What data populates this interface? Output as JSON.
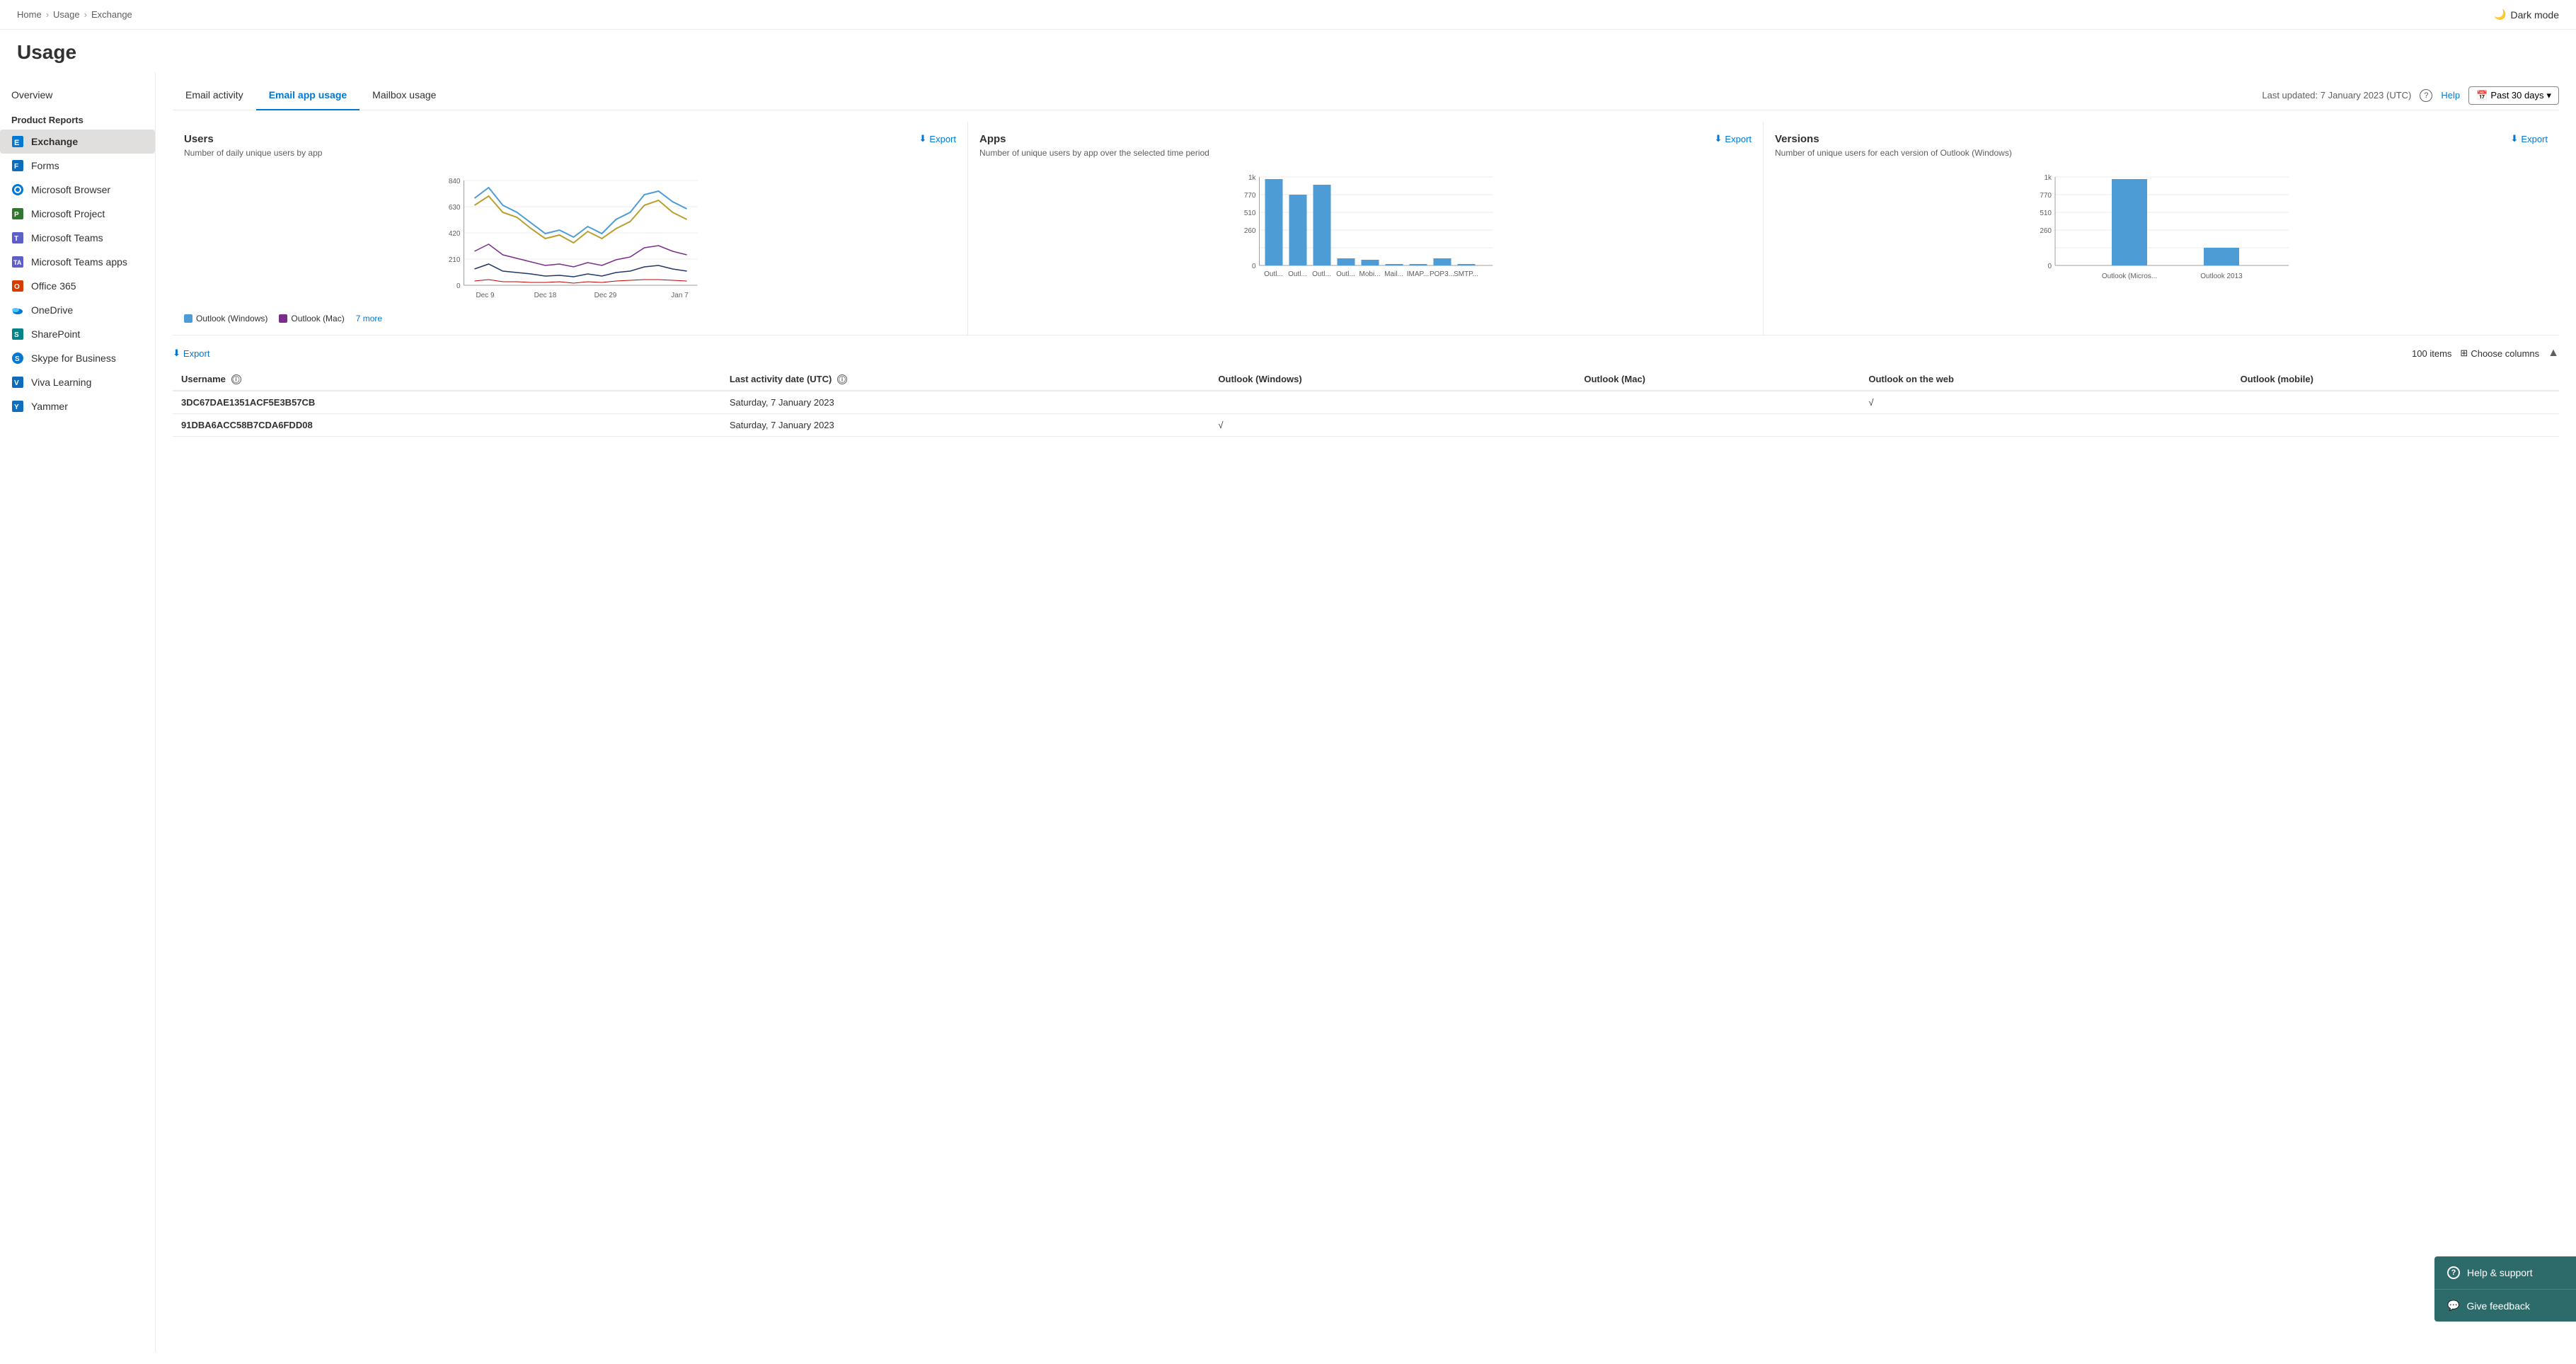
{
  "breadcrumb": {
    "home": "Home",
    "usage": "Usage",
    "exchange": "Exchange",
    "sep": "›"
  },
  "darkMode": {
    "label": "Dark mode"
  },
  "page": {
    "title": "Usage"
  },
  "sidebar": {
    "overview_label": "Overview",
    "section_title": "Product Reports",
    "items": [
      {
        "id": "exchange",
        "label": "Exchange",
        "icon": "📊",
        "active": true
      },
      {
        "id": "forms",
        "label": "Forms",
        "icon": "📋",
        "active": false
      },
      {
        "id": "microsoft-browser",
        "label": "Microsoft Browser",
        "icon": "🌐",
        "active": false
      },
      {
        "id": "microsoft-project",
        "label": "Microsoft Project",
        "icon": "📁",
        "active": false
      },
      {
        "id": "microsoft-teams",
        "label": "Microsoft Teams",
        "icon": "💬",
        "active": false
      },
      {
        "id": "microsoft-teams-apps",
        "label": "Microsoft Teams apps",
        "icon": "🔧",
        "active": false
      },
      {
        "id": "office-365",
        "label": "Office 365",
        "icon": "🔴",
        "active": false
      },
      {
        "id": "onedrive",
        "label": "OneDrive",
        "icon": "☁️",
        "active": false
      },
      {
        "id": "sharepoint",
        "label": "SharePoint",
        "icon": "🔷",
        "active": false
      },
      {
        "id": "skype-business",
        "label": "Skype for Business",
        "icon": "🔵",
        "active": false
      },
      {
        "id": "viva-learning",
        "label": "Viva Learning",
        "icon": "📘",
        "active": false
      },
      {
        "id": "yammer",
        "label": "Yammer",
        "icon": "🟡",
        "active": false
      }
    ]
  },
  "tabs": {
    "items": [
      {
        "id": "email-activity",
        "label": "Email activity",
        "active": false
      },
      {
        "id": "email-app-usage",
        "label": "Email app usage",
        "active": true
      },
      {
        "id": "mailbox-usage",
        "label": "Mailbox usage",
        "active": false
      }
    ],
    "meta": {
      "last_updated": "Last updated: 7 January 2023 (UTC)",
      "help_label": "Help",
      "period_label": "Past 30 days"
    }
  },
  "charts": {
    "users": {
      "title": "Users",
      "subtitle": "Number of daily unique users by app",
      "export_label": "Export",
      "y_labels": [
        "840",
        "630",
        "420",
        "210",
        "0"
      ],
      "x_labels": [
        "Dec 9",
        "Dec 18",
        "Dec 29",
        "Jan 7"
      ],
      "legend": [
        {
          "label": "Outlook (Windows)",
          "color": "#4e9cd6"
        },
        {
          "label": "Outlook (Mac)",
          "color": "#7b2d8b"
        }
      ],
      "more_label": "7 more"
    },
    "apps": {
      "title": "Apps",
      "subtitle": "Number of unique users by app over the selected time period",
      "export_label": "Export",
      "y_labels": [
        "1k",
        "770",
        "510",
        "260",
        "0"
      ],
      "x_labels": [
        "Outl...",
        "Outl...",
        "Outl...",
        "Outl...",
        "Mobi...",
        "Mail...",
        "IMAP...",
        "POP3...",
        "SMTP..."
      ],
      "bars": [
        {
          "label": "Outl...",
          "value": 980,
          "height": 92
        },
        {
          "label": "Outl...",
          "value": 760,
          "height": 72
        },
        {
          "label": "Outl...",
          "value": 860,
          "height": 81
        },
        {
          "label": "Outl...",
          "value": 75,
          "height": 7
        },
        {
          "label": "Mobi...",
          "value": 65,
          "height": 6
        },
        {
          "label": "Mail...",
          "value": 5,
          "height": 1
        },
        {
          "label": "IMAP...",
          "value": 3,
          "height": 1
        },
        {
          "label": "POP3...",
          "value": 70,
          "height": 7
        },
        {
          "label": "SMTP...",
          "value": 3,
          "height": 1
        }
      ]
    },
    "versions": {
      "title": "Versions",
      "subtitle": "Number of unique users for each version of Outlook (Windows)",
      "export_label": "Export",
      "y_labels": [
        "1k",
        "770",
        "510",
        "260",
        "0"
      ],
      "x_labels": [
        "Outlook (Micros...",
        "Outlook 2013"
      ],
      "bars": [
        {
          "label": "Outlook (Micros...",
          "value": 1000,
          "height": 94
        },
        {
          "label": "Outlook 2013",
          "value": 200,
          "height": 19
        }
      ]
    }
  },
  "table": {
    "export_label": "Export",
    "items_count": "100 items",
    "columns": [
      {
        "id": "username",
        "label": "Username",
        "has_info": true
      },
      {
        "id": "last_activity",
        "label": "Last activity date (UTC)",
        "has_info": true
      },
      {
        "id": "outlook_windows",
        "label": "Outlook (Windows)",
        "has_info": false
      },
      {
        "id": "outlook_mac",
        "label": "Outlook (Mac)",
        "has_info": false
      },
      {
        "id": "outlook_web",
        "label": "Outlook on the web",
        "has_info": false
      },
      {
        "id": "outlook_mobile",
        "label": "Outlook (mobile)",
        "has_info": false
      }
    ],
    "choose_columns_label": "Choose columns",
    "rows": [
      {
        "username": "3DC67DAE1351ACF5E3B57CB",
        "last_activity": "Saturday, 7 January 2023",
        "outlook_windows": "",
        "outlook_mac": "",
        "outlook_web": "√",
        "outlook_mobile": ""
      },
      {
        "username": "91DBA6ACC58B7CDA6FDD08",
        "last_activity": "Saturday, 7 January 2023",
        "outlook_windows": "√",
        "outlook_mac": "",
        "outlook_web": "",
        "outlook_mobile": ""
      }
    ]
  },
  "floating_panel": {
    "items": [
      {
        "id": "help-support",
        "label": "Help & support",
        "icon": "?"
      },
      {
        "id": "give-feedback",
        "label": "Give feedback",
        "icon": "💬"
      }
    ]
  }
}
